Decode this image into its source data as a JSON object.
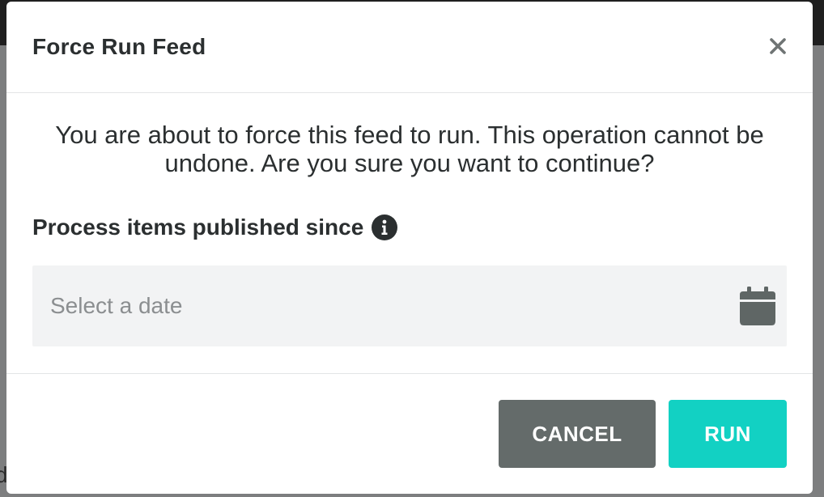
{
  "background": {
    "partial_text": "d"
  },
  "modal": {
    "title": "Force Run Feed",
    "close_label": "×",
    "message": "You are about to force this feed to run. This operation cannot be undone. Are you sure you want to continue?",
    "field_label": "Process items published since",
    "date_input": {
      "value": "",
      "placeholder": "Select a date"
    },
    "buttons": {
      "cancel": "CANCEL",
      "run": "RUN"
    }
  },
  "icons": {
    "close": "close-icon",
    "info": "info-icon",
    "calendar": "calendar-icon"
  },
  "colors": {
    "title_text": "#2b2f30",
    "cancel_button": "#646b6a",
    "run_button": "#12d1c3",
    "input_background": "#f2f3f4",
    "icon": "#5f6665"
  }
}
